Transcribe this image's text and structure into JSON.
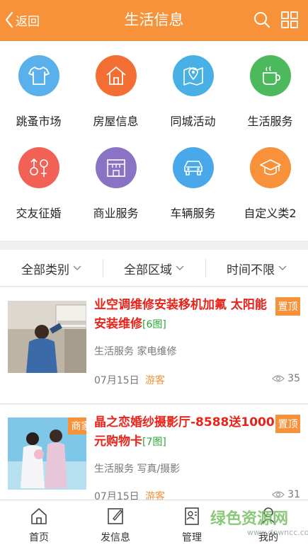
{
  "header": {
    "back_label": "返回",
    "title": "生活信息"
  },
  "categories": [
    {
      "label": "跳蚤市场",
      "color": "#5ab0ea",
      "icon": "tshirt-icon"
    },
    {
      "label": "房屋信息",
      "color": "#f36e32",
      "icon": "house-icon"
    },
    {
      "label": "同城活动",
      "color": "#49b0e6",
      "icon": "map-pin-icon"
    },
    {
      "label": "生活服务",
      "color": "#4cba5c",
      "icon": "coffee-cup-icon"
    },
    {
      "label": "交友征婚",
      "color": "#f26156",
      "icon": "gender-icon"
    },
    {
      "label": "商业服务",
      "color": "#8a73c5",
      "icon": "storefront-icon"
    },
    {
      "label": "车辆服务",
      "color": "#49a8ea",
      "icon": "car-icon"
    },
    {
      "label": "自定义类2",
      "color": "#f7923a",
      "icon": "graduation-cap-icon"
    }
  ],
  "filters": [
    "全部类别",
    "全部区域",
    "时间不限"
  ],
  "listings": [
    {
      "title": "业空调维修安装移机加氟 太阳能安装维修",
      "pic_count": "[6图]",
      "badge": "置顶",
      "category": "生活服务 家电维修",
      "date": "07月15日",
      "author": "游客",
      "views": "35"
    },
    {
      "title": "晶之恋婚纱摄影厅-8588送1000元购物卡",
      "pic_count": "[7图]",
      "badge": "置顶",
      "merchant_tag": "商家",
      "category": "生活服务 写真/摄影",
      "date": "07月15日",
      "author": "游客",
      "views": "31"
    }
  ],
  "tabbar": [
    {
      "label": "首页",
      "icon": "home-icon"
    },
    {
      "label": "发信息",
      "icon": "compose-icon"
    },
    {
      "label": "管理",
      "icon": "manage-icon"
    },
    {
      "label": "我的",
      "icon": "user-icon"
    }
  ],
  "watermark": {
    "main": "绿色资源网",
    "sub": "www.downcc.com"
  }
}
